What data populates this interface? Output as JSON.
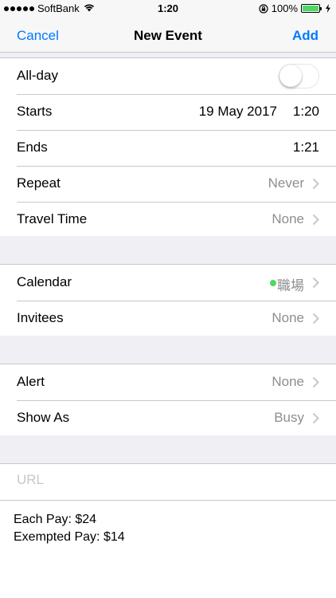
{
  "status_bar": {
    "carrier": "SoftBank",
    "time": "1:20",
    "battery": "100%",
    "battery_level": 1.0,
    "signal_bars": 5
  },
  "nav": {
    "cancel": "Cancel",
    "title": "New Event",
    "add": "Add"
  },
  "group1": {
    "allday_label": "All-day",
    "allday_on": false,
    "starts_label": "Starts",
    "starts_date": "19 May 2017",
    "starts_time": "1:20",
    "ends_label": "Ends",
    "ends_time": "1:21",
    "repeat_label": "Repeat",
    "repeat_value": "Never",
    "travel_label": "Travel Time",
    "travel_value": "None"
  },
  "group2": {
    "calendar_label": "Calendar",
    "calendar_value": "職場",
    "calendar_color": "#4cd964",
    "invitees_label": "Invitees",
    "invitees_value": "None"
  },
  "group3": {
    "alert_label": "Alert",
    "alert_value": "None",
    "showas_label": "Show As",
    "showas_value": "Busy"
  },
  "group4": {
    "url_placeholder": "URL",
    "url_value": ""
  },
  "notes": {
    "line1": "Each Pay: $24",
    "line2": "Exempted Pay: $14"
  },
  "colors": {
    "accent": "#007aff",
    "secondary_text": "#8e8e93",
    "separator": "#c8c7cc",
    "group_background": "#efeff4"
  },
  "icons": {
    "chevron": "chevron-right-icon",
    "wifi": "wifi-icon",
    "lock": "rotation-lock-icon",
    "charging": "charging-bolt-icon"
  }
}
